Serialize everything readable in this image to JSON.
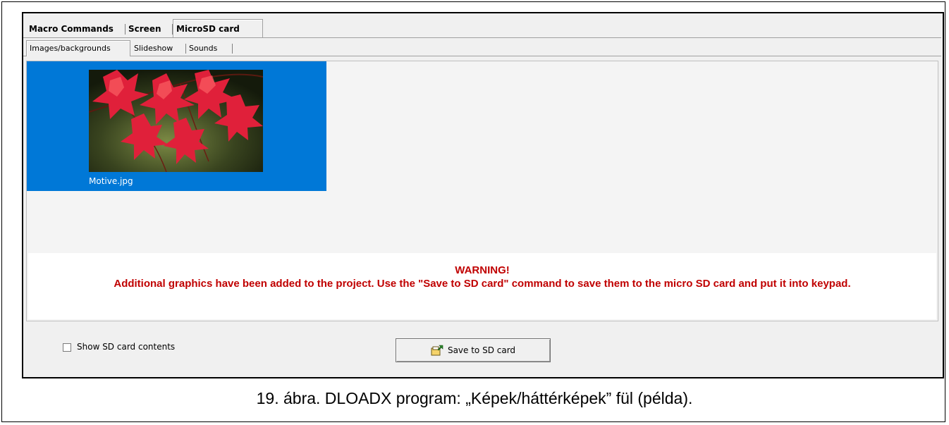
{
  "main_tabs": [
    "Macro Commands",
    "Screen",
    "MicroSD card"
  ],
  "sub_tabs": [
    "Images/backgrounds",
    "Slideshow",
    "Sounds"
  ],
  "thumbnail": {
    "filename": "Motive.jpg"
  },
  "warning": {
    "title": "WARNING!",
    "body": "Additional graphics have been added to the project. Use the \"Save to SD card\" command to save them to the micro SD card and put it into keypad."
  },
  "show_contents_label": "Show SD card contents",
  "save_button_label": "Save to SD card",
  "figure_caption": "19. ábra. DLOADX program: „Képek/háttérképek” fül (példa).",
  "colors": {
    "selection": "#0078d7",
    "warning_text": "#c00000"
  }
}
